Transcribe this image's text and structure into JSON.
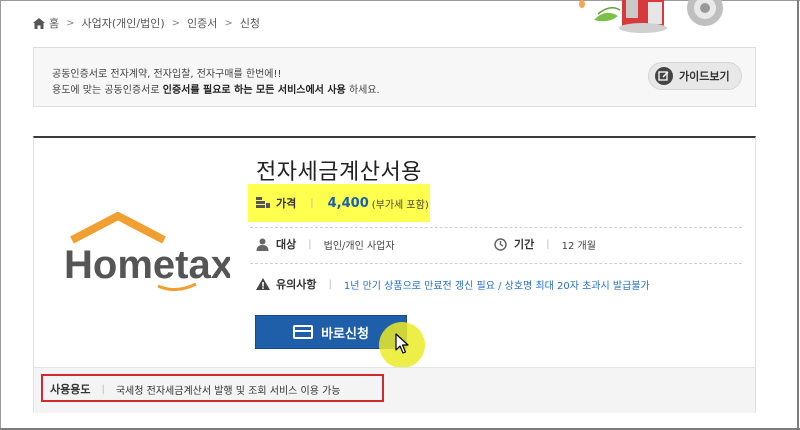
{
  "breadcrumb": {
    "items": [
      "홈",
      "사업자(개인/법인)",
      "인증서",
      "신청"
    ]
  },
  "intro": {
    "line1": "공동인증서로 전자계약, 전자입찰, 전자구매를 한번에!!",
    "line2_pre": "용도에 맞는 공동인증서로 ",
    "line2_bold": "인증서를 필요로 하는 모든 서비스에서 사용",
    "line2_post": " 하세요.",
    "guide_label": "가이드보기"
  },
  "product": {
    "logo_text": "Hometax.",
    "title": "전자세금계산서용",
    "price_label": "가격",
    "price": "4,400",
    "price_note": "(부가세 포함)",
    "target_label": "대상",
    "target_value": "법인/개인 사업자",
    "period_label": "기간",
    "period_value": "12 개월",
    "caution_label": "유의사항",
    "caution_value": "1년 만기 상품으로 만료전 갱신 필요 / 상호명 최대 20자 초과시 발급불가",
    "apply_label": "바로신청",
    "usage_label": "사용용도",
    "usage_value": "국세청 전자세금계산서 발행 및 조회 서비스 이용 가능"
  },
  "colors": {
    "accent_blue": "#1f5ea8",
    "highlight_yellow": "#ffff4d",
    "annotation_red": "#d32b2b",
    "logo_orange": "#f0a030",
    "logo_gray": "#555555"
  }
}
